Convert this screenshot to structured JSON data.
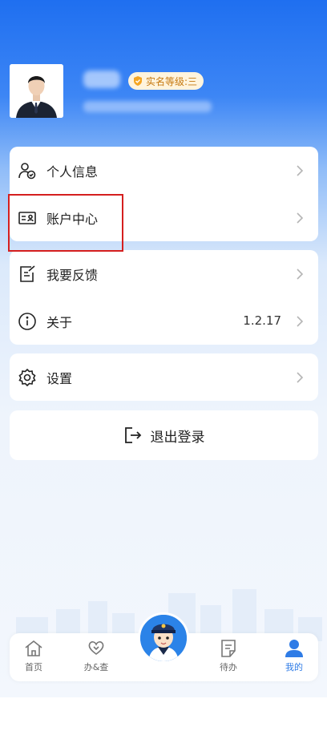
{
  "profile": {
    "badge_label": "实名等级:三"
  },
  "menu_group1": {
    "personal_info": "个人信息",
    "account_center": "账户中心"
  },
  "menu_group2": {
    "feedback": "我要反馈",
    "about": "关于",
    "version": "1.2.17"
  },
  "menu_group3": {
    "settings": "设置"
  },
  "logout_label": "退出登录",
  "tabbar": {
    "home": "首页",
    "service": "办&查",
    "todo": "待办",
    "mine": "我的"
  },
  "colors": {
    "accent": "#2f7ce6",
    "highlight": "#d51f1f",
    "badge_text": "#c67a12"
  }
}
